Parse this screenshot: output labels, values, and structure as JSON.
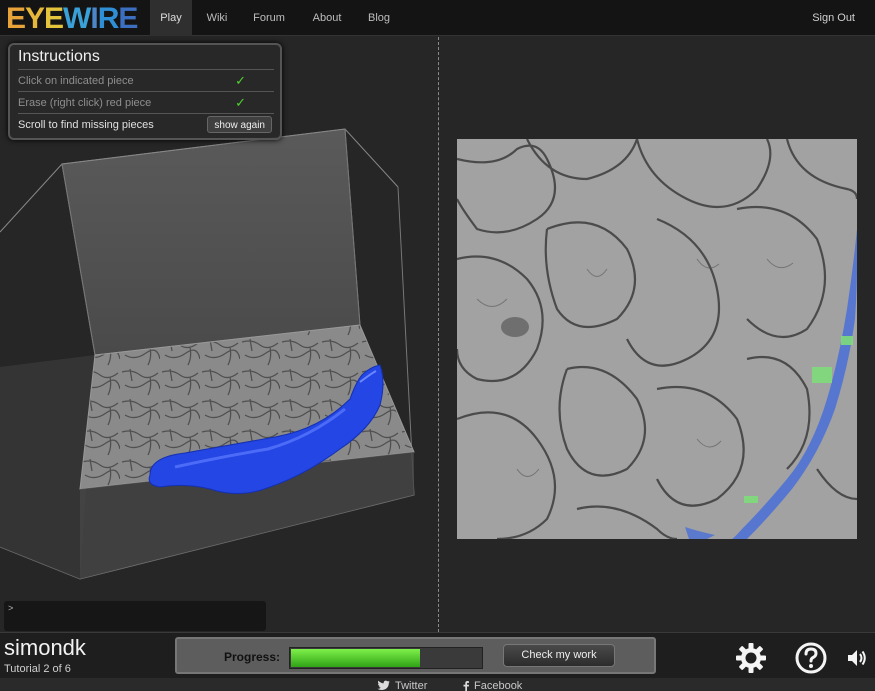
{
  "logo": {
    "text": "EYEWIRE",
    "letters": [
      "E",
      "Y",
      "E",
      "W",
      "I",
      "R",
      "E"
    ],
    "colors": [
      "#e8a23a",
      "#e6b83a",
      "#e3c43c",
      "#3aa0d8",
      "#4c86c8",
      "#2f8fd6",
      "#3c6fc0"
    ]
  },
  "nav": {
    "items": [
      {
        "label": "Play",
        "active": true
      },
      {
        "label": "Wiki",
        "active": false
      },
      {
        "label": "Forum",
        "active": false
      },
      {
        "label": "About",
        "active": false
      },
      {
        "label": "Blog",
        "active": false
      }
    ],
    "sign_out": "Sign Out"
  },
  "instructions": {
    "title": "Instructions",
    "steps": [
      {
        "text": "Click on indicated piece",
        "done": true
      },
      {
        "text": "Erase (right click) red piece",
        "done": true
      },
      {
        "text": "Scroll to find missing pieces",
        "done": false
      }
    ],
    "check_glyph": "✓",
    "show_again_label": "show again"
  },
  "console": {
    "prompt": ">"
  },
  "user": {
    "name": "simondk",
    "tutorial": "Tutorial 2 of 6"
  },
  "progress": {
    "label": "Progress:",
    "fraction": 0.68
  },
  "actions": {
    "check_work_label": "Check my work"
  },
  "icons": {
    "settings": "gear-icon",
    "help": "help-icon",
    "sound": "speaker-icon"
  },
  "footer": {
    "twitter_label": "Twitter",
    "facebook_label": "Facebook"
  },
  "colors": {
    "segment_blue": "#2a4fe0",
    "overlay_blue": "#4a6fd8",
    "seed_green": "#7ddc7a",
    "progress_green": "#4ccd23"
  }
}
